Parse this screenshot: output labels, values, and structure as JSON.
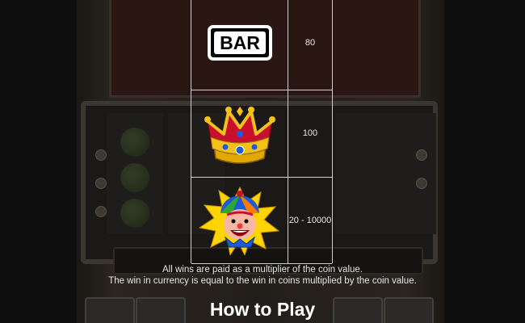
{
  "paytable": {
    "rows": [
      {
        "symbol": "bar-symbol",
        "symbol_text": "BAR",
        "payout": "80"
      },
      {
        "symbol": "crown-symbol",
        "payout": "100"
      },
      {
        "symbol": "jester-symbol",
        "payout": "20 - 10000"
      }
    ]
  },
  "notes": {
    "line1": "All wins are paid as a multiplier of the coin value.",
    "line2": "The win in currency is equal to the win in coins multiplied by the coin value."
  },
  "section_title": "How to Play",
  "colors": {
    "table_border": "#cfcfcf",
    "crown_gold": "#f2c21a",
    "crown_red": "#c8102e",
    "jester_yellow": "#ffd400",
    "jester_blue": "#1e5bd8"
  }
}
